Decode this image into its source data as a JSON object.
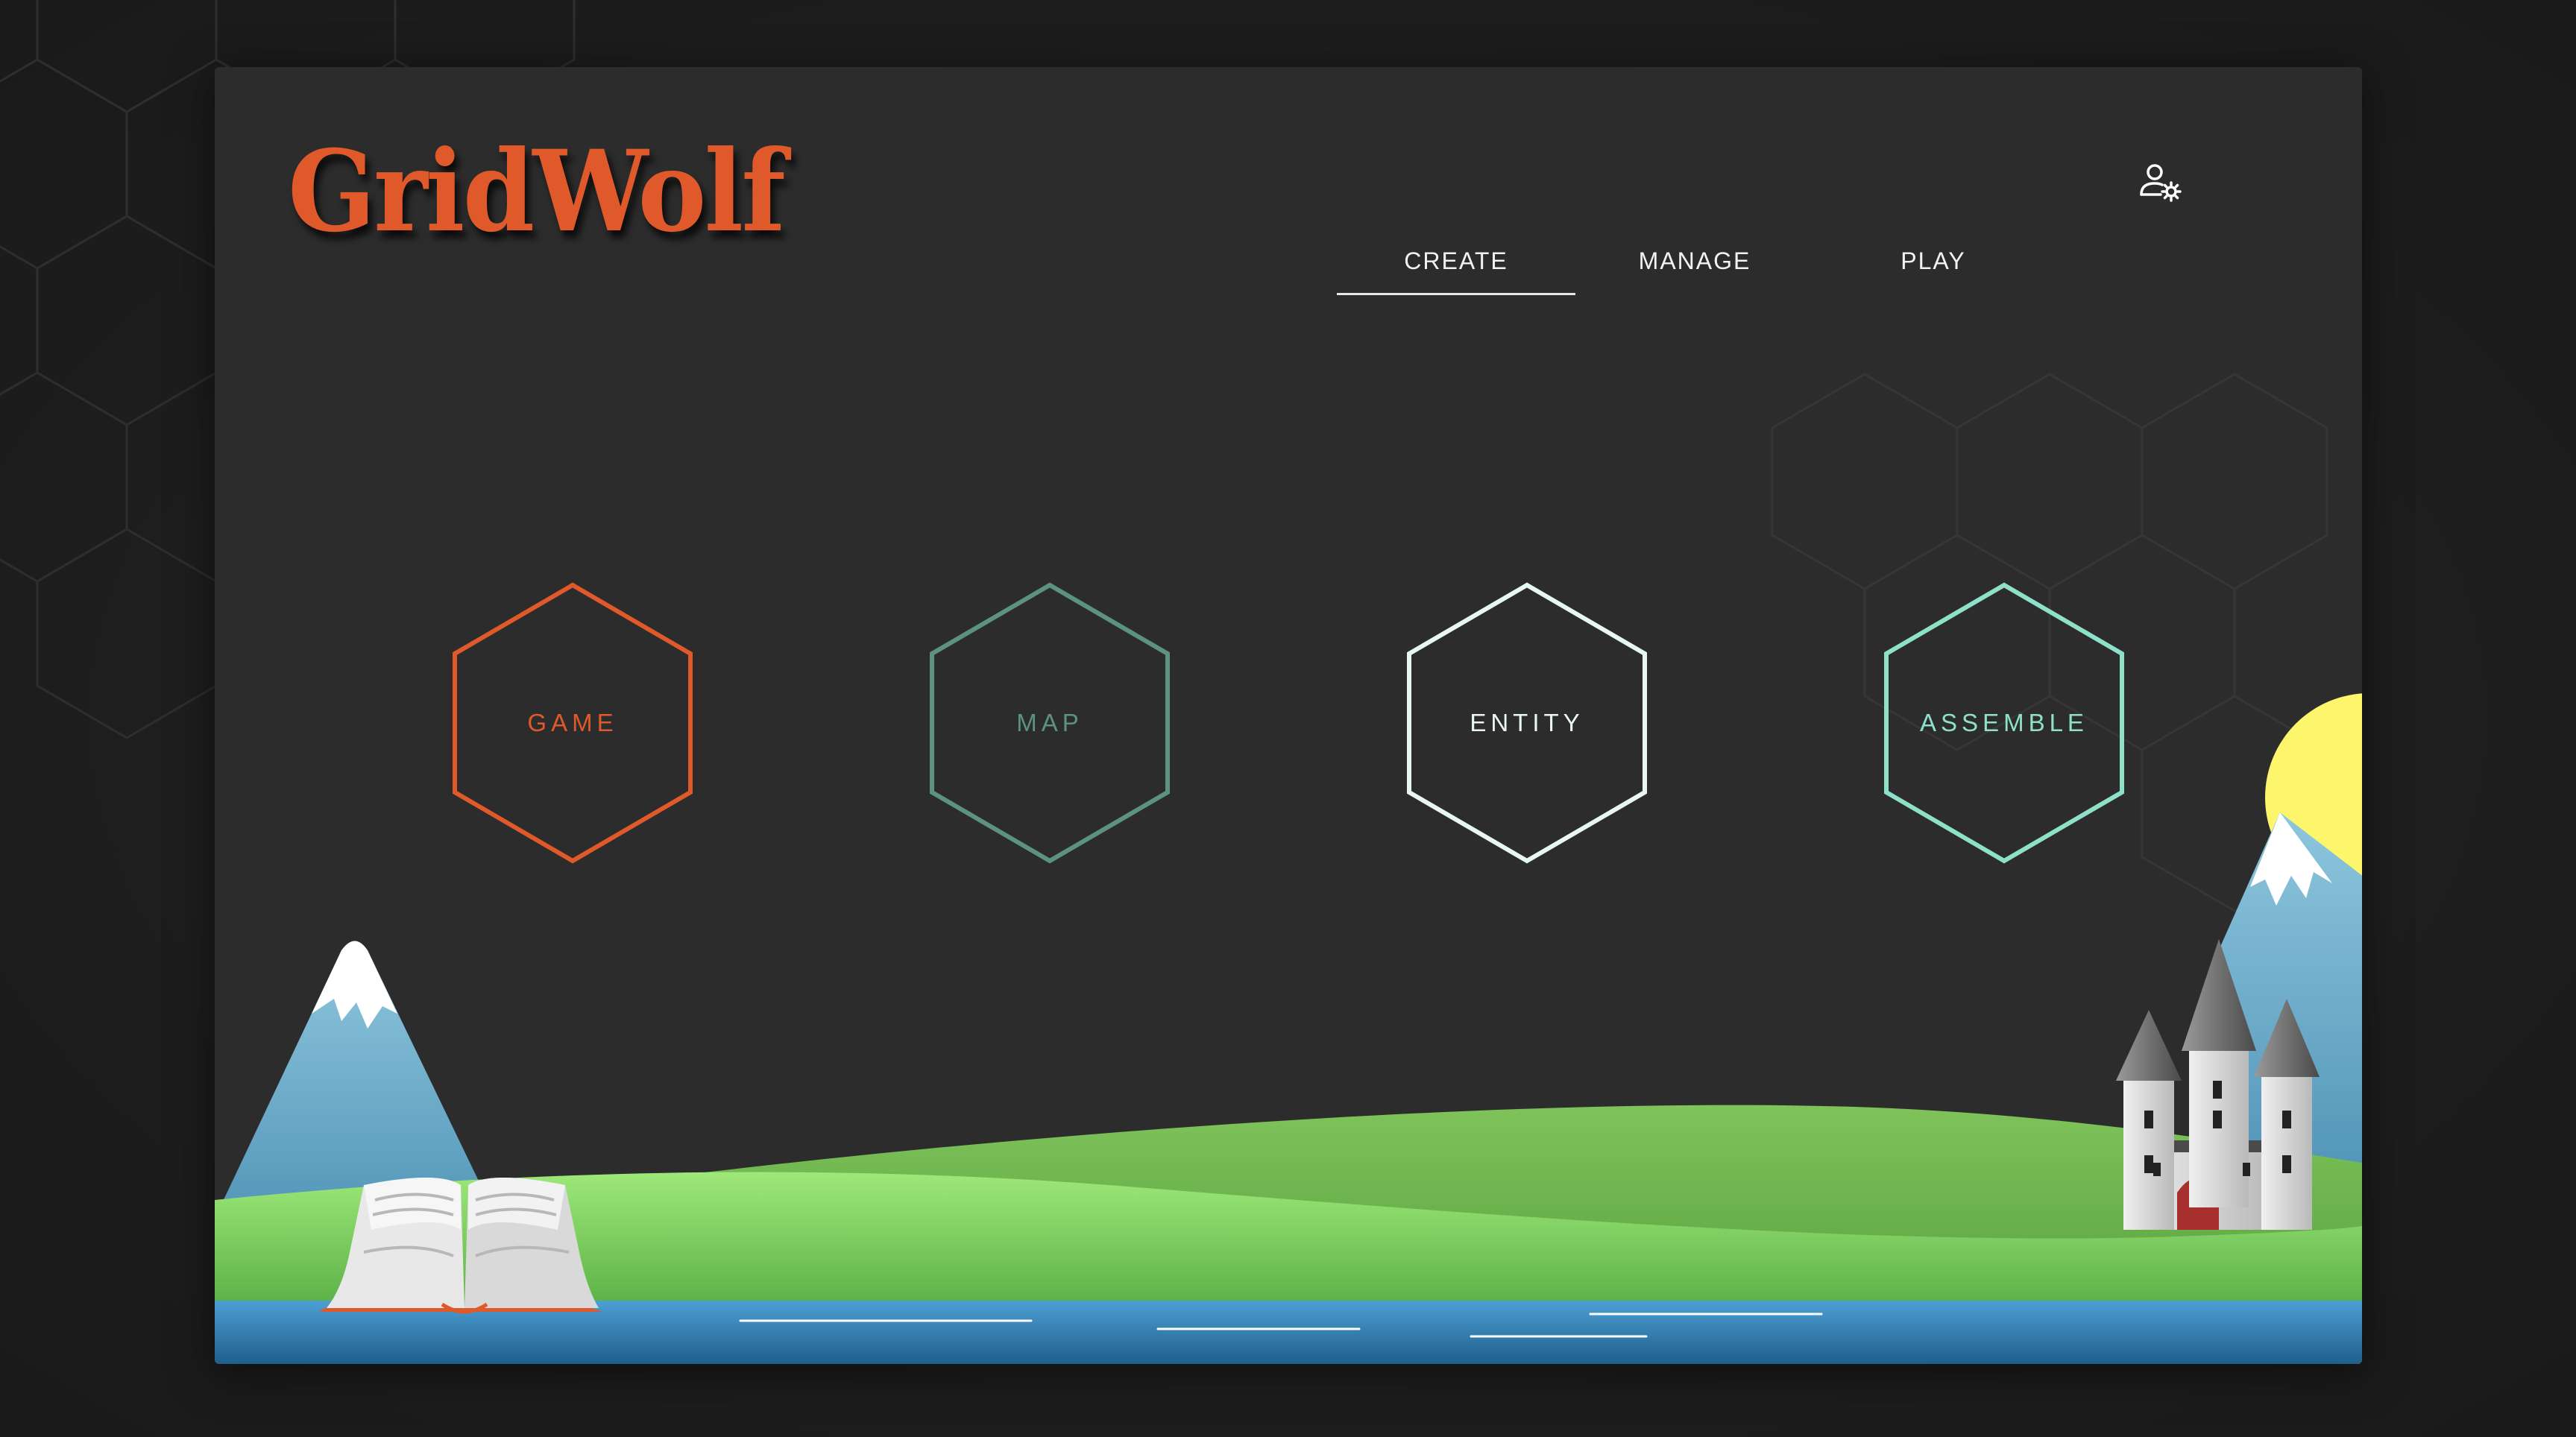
{
  "app": {
    "logo_text": "GridWolf"
  },
  "nav": {
    "items": [
      {
        "label": "CREATE",
        "active": true
      },
      {
        "label": "MANAGE",
        "active": false
      },
      {
        "label": "PLAY",
        "active": false
      }
    ],
    "account_icon": "user-settings-icon"
  },
  "actions": [
    {
      "label": "GAME",
      "color": "#e0592a"
    },
    {
      "label": "MAP",
      "color": "#5c9282"
    },
    {
      "label": "ENTITY",
      "color": "#e9f7f3"
    },
    {
      "label": "ASSEMBLE",
      "color": "#8fe0c9"
    }
  ],
  "theme": {
    "background": "#2c2c2c",
    "accent": "#e0592a"
  }
}
